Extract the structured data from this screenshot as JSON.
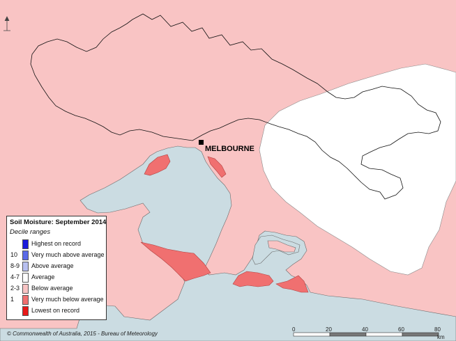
{
  "map": {
    "legend": {
      "title": "Soil Moisture: September 2014",
      "subtitle": "Decile ranges",
      "items": [
        {
          "code": "",
          "label": "Highest on record",
          "color": "#1a1adc"
        },
        {
          "code": "10",
          "label": "Very much above average",
          "color": "#5a6ae8"
        },
        {
          "code": "8-9",
          "label": "Above average",
          "color": "#b8c0f0"
        },
        {
          "code": "4-7",
          "label": "Average",
          "color": "#ffffff"
        },
        {
          "code": "2-3",
          "label": "Below average",
          "color": "#f9c4c4"
        },
        {
          "code": "1",
          "label": "Very much below average",
          "color": "#f07070"
        },
        {
          "code": "",
          "label": "Lowest on record",
          "color": "#e81818"
        }
      ]
    },
    "city": {
      "name": "MELBOURNE"
    },
    "copyright": "© Commonwealth of Australia, 2015 - Bureau of Meteorology",
    "scale_bar": {
      "ticks": [
        "0",
        "20",
        "40",
        "60",
        "80"
      ],
      "unit": "km"
    },
    "colors": {
      "sea": "#cbdce2",
      "below_average": "#f9c4c4",
      "average": "#ffffff",
      "very_much_below": "#f07070"
    }
  }
}
